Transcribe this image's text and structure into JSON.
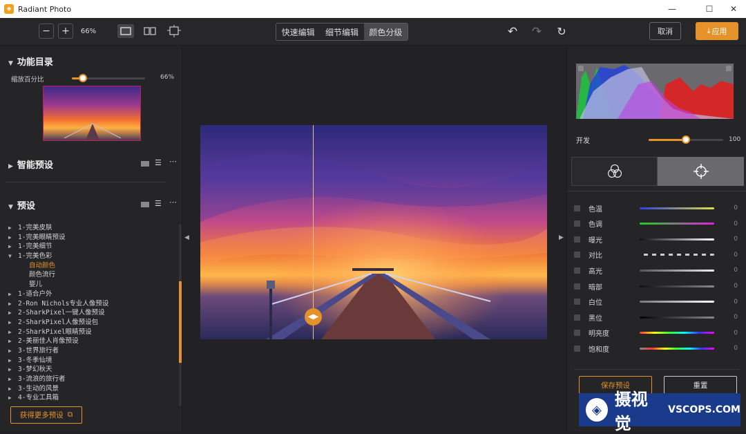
{
  "window": {
    "title": "Radiant Photo"
  },
  "toolbar": {
    "zoom_out": "−",
    "zoom_in": "+",
    "zoom_level": "66%",
    "tabs": [
      {
        "label": "快速编辑",
        "active": false
      },
      {
        "label": "细节编辑",
        "active": false
      },
      {
        "label": "颜色分级",
        "active": true
      }
    ],
    "cancel_label": "取消",
    "apply_label": "应用"
  },
  "left": {
    "catalog_title": "功能目录",
    "zoom_label": "缩放百分比",
    "zoom_value": "66%",
    "zoom_fraction": 0.15,
    "smart_preset_title": "智能预设",
    "preset_title": "预设",
    "tree": [
      {
        "label": "1-完美皮肤",
        "expanded": false,
        "level": 0
      },
      {
        "label": "1-完美眼睛预设",
        "expanded": false,
        "level": 0
      },
      {
        "label": "1-完美细节",
        "expanded": false,
        "level": 0
      },
      {
        "label": "1-完美色彩",
        "expanded": true,
        "level": 0
      },
      {
        "label": "自动颜色",
        "level": 1,
        "selected": true
      },
      {
        "label": "颜色流行",
        "level": 1
      },
      {
        "label": "婴儿",
        "level": 1
      },
      {
        "label": "1-适合户外",
        "expanded": false,
        "level": 0
      },
      {
        "label": "2-Ron Nichols专业人像预设",
        "expanded": false,
        "level": 0
      },
      {
        "label": "2-SharkPixel一键人像预设",
        "expanded": false,
        "level": 0
      },
      {
        "label": "2-SharkPixel人像预设包",
        "expanded": false,
        "level": 0
      },
      {
        "label": "2-SharkPixel眼睛预设",
        "expanded": false,
        "level": 0
      },
      {
        "label": "2-美丽佳人肖像预设",
        "expanded": false,
        "level": 0
      },
      {
        "label": "3-世界旅行者",
        "expanded": false,
        "level": 0
      },
      {
        "label": "3-冬季仙境",
        "expanded": false,
        "level": 0
      },
      {
        "label": "3-梦幻秋天",
        "expanded": false,
        "level": 0
      },
      {
        "label": "3-流浪的旅行者",
        "expanded": false,
        "level": 0
      },
      {
        "label": "3-生动的风景",
        "expanded": false,
        "level": 0
      },
      {
        "label": "4-专业工具箱",
        "expanded": false,
        "level": 0
      }
    ],
    "more_presets_label": "获得更多预设"
  },
  "right": {
    "develop_label": "开发",
    "develop_value": "100",
    "develop_fraction": 0.5,
    "adjustments": [
      {
        "label": "色温",
        "value": "0"
      },
      {
        "label": "色调",
        "value": "0"
      },
      {
        "label": "曝光",
        "value": "0"
      },
      {
        "label": "对比",
        "value": "0"
      },
      {
        "label": "高光",
        "value": "0"
      },
      {
        "label": "暗部",
        "value": "0"
      },
      {
        "label": "白位",
        "value": "0"
      },
      {
        "label": "黑位",
        "value": "0"
      },
      {
        "label": "明亮度",
        "value": "0"
      },
      {
        "label": "饱和度",
        "value": "0"
      }
    ],
    "save_preset_label": "保存预设",
    "reset_label": "重置"
  },
  "watermark": {
    "text": "摄视觉",
    "domain": "VSCOPS.COM"
  },
  "colors": {
    "accent": "#e5922a"
  }
}
